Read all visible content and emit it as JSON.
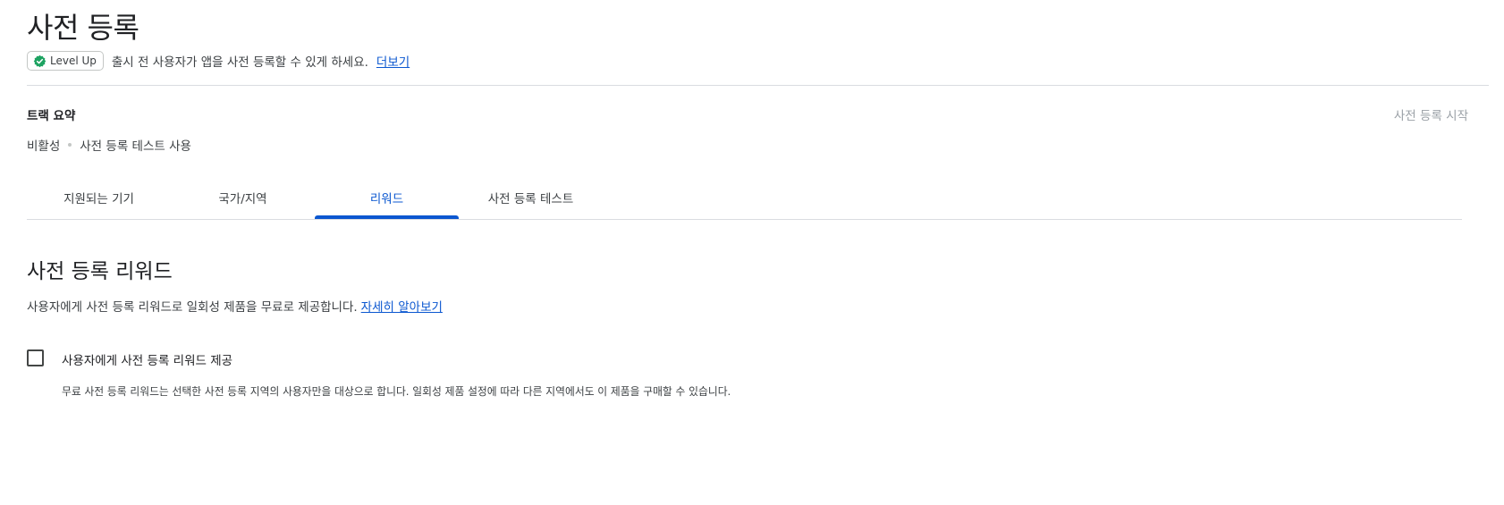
{
  "page": {
    "title": "사전 등록",
    "badge_label": "Level Up",
    "badge_icon": "verified-badge-icon",
    "subtitle": "출시 전 사용자가 앱을 사전 등록할 수 있게 하세요.",
    "subtitle_link": "더보기"
  },
  "track": {
    "title": "트랙 요약",
    "action": "사전 등록 시작",
    "status": "비활성",
    "status_detail": "사전 등록 테스트 사용"
  },
  "tabs": [
    {
      "label": "지원되는 기기",
      "active": false
    },
    {
      "label": "국가/지역",
      "active": false
    },
    {
      "label": "리워드",
      "active": true
    },
    {
      "label": "사전 등록 테스트",
      "active": false
    }
  ],
  "rewards": {
    "title": "사전 등록 리워드",
    "description": "사용자에게 사전 등록 리워드로 일회성 제품을 무료로 제공합니다.",
    "learn_more": "자세히 알아보기",
    "checkbox_label": "사용자에게 사전 등록 리워드 제공",
    "checkbox_checked": false,
    "helper": "무료 사전 등록 리워드는 선택한 사전 등록 지역의 사용자만을 대상으로 합니다. 일회성 제품 설정에 따라 다른 지역에서도 이 제품을 구매할 수 있습니다."
  },
  "colors": {
    "accent": "#0b57d0",
    "badge_green": "#1ea362"
  }
}
